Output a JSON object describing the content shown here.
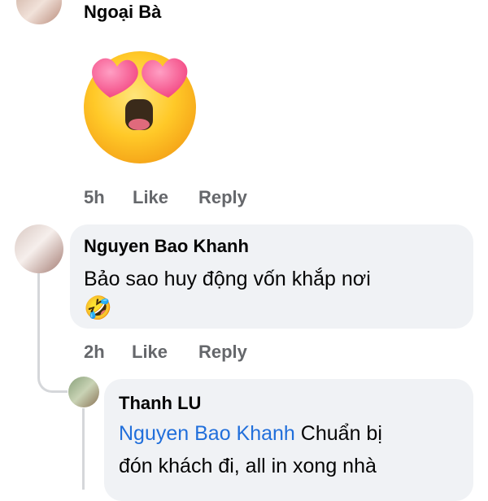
{
  "comments": [
    {
      "author": "Ngoại Bà",
      "sticker": "heart-eyes-emoji",
      "meta": {
        "time": "5h",
        "like": "Like",
        "reply": "Reply"
      }
    },
    {
      "author": "Nguyen Bao Khanh",
      "text": "Bảo sao huy động vốn khắp nơi",
      "emoji": "🤣",
      "meta": {
        "time": "2h",
        "like": "Like",
        "reply": "Reply"
      }
    },
    {
      "author": "Thanh LU",
      "mention": "Nguyen Bao Khanh",
      "text_line1": "Chuẩn bị",
      "text_line2": "đón khách đi, all in xong nhà"
    }
  ],
  "colors": {
    "bubble": "#f0f2f5",
    "meta": "#65676b",
    "mention": "#216fdb",
    "thread_line": "#d5d7da"
  }
}
